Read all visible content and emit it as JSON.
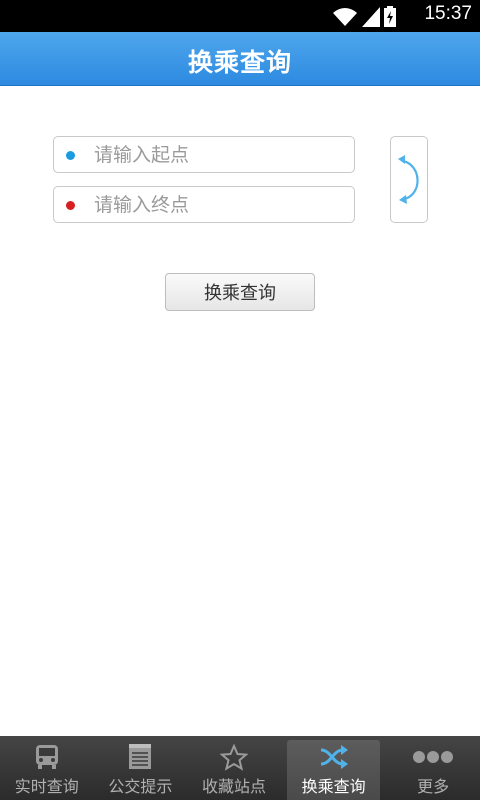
{
  "status_bar": {
    "time": "15:37"
  },
  "header": {
    "title": "换乘查询"
  },
  "form": {
    "start_placeholder": "请输入起点",
    "start_value": "",
    "end_placeholder": "请输入终点",
    "end_value": "",
    "search_label": "换乘查询"
  },
  "colors": {
    "start_dot": "#1a9be0",
    "end_dot": "#d61f1f",
    "header": "#3a97e6",
    "accent": "#4fb3ea"
  },
  "tabs": [
    {
      "label": "实时查询",
      "icon": "bus-icon",
      "active": false
    },
    {
      "label": "公交提示",
      "icon": "notepad-icon",
      "active": false
    },
    {
      "label": "收藏站点",
      "icon": "star-icon",
      "active": false
    },
    {
      "label": "换乘查询",
      "icon": "shuffle-icon",
      "active": true
    },
    {
      "label": "更多",
      "icon": "more-dots-icon",
      "active": false
    }
  ]
}
